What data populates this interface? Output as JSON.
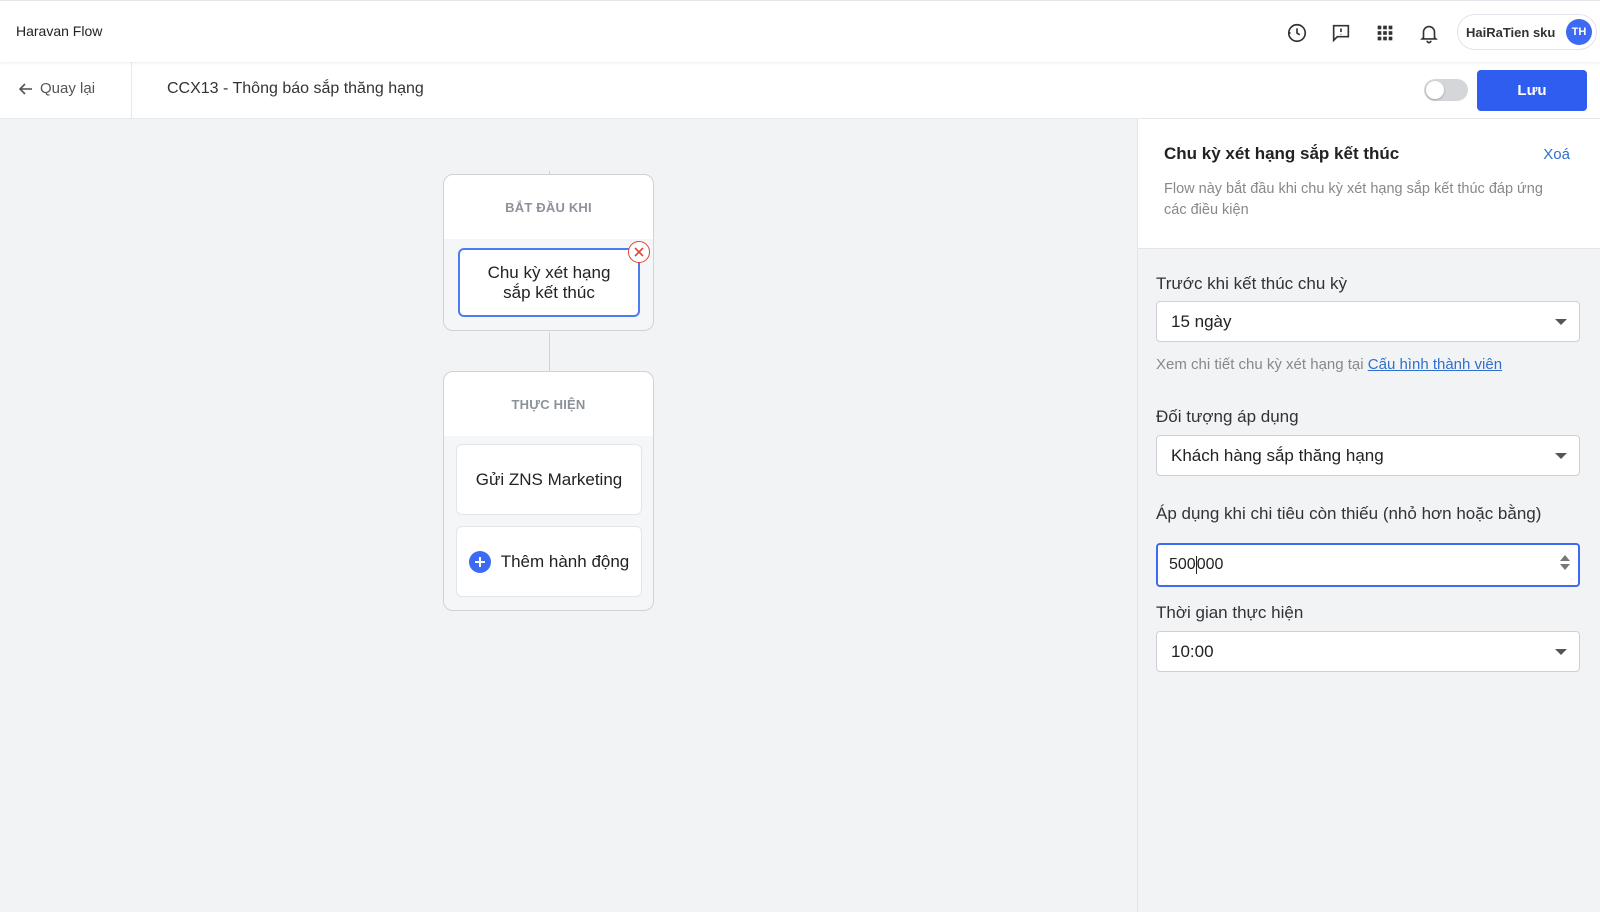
{
  "header": {
    "brand": "Haravan Flow",
    "icons": [
      "history-icon",
      "feedback-icon",
      "apps-grid-icon",
      "bell-icon"
    ],
    "user": {
      "name": "HaiRaTien sku",
      "initials": "TH"
    },
    "accent_color": "#2f5df0"
  },
  "subheader": {
    "back_label": "Quay lại",
    "flow_title": "CCX13 - Thông báo sắp thăng hạng",
    "active_toggle": false,
    "save_label": "Lưu"
  },
  "canvas": {
    "trigger_group": {
      "title": "BẮT ĐẦU KHI",
      "trigger_label": "Chu kỳ xét hạng sắp kết thúc"
    },
    "action_group": {
      "title": "THỰC HIỆN",
      "actions": [
        "Gửi ZNS Marketing"
      ],
      "add_action_label": "Thêm hành động"
    }
  },
  "panel": {
    "title": "Chu kỳ xét hạng sắp kết thúc",
    "delete_label": "Xoá",
    "description": "Flow này bắt đầu khi chu kỳ xét hạng sắp kết thúc đáp ứng các điều kiện",
    "fields": {
      "before_end": {
        "label": "Trước khi kết thúc chu kỳ",
        "value": "15 ngày"
      },
      "hint_text": "Xem chi tiết chu kỳ xét hạng tại",
      "hint_link": "Cấu hình thành viên",
      "target": {
        "label": "Đối tượng áp dụng",
        "value": "Khách hàng sắp thăng hạng"
      },
      "spend_gap": {
        "label": "Áp dụng khi chi tiêu còn thiếu (nhỏ hơn hoặc bằng)",
        "value_before_cursor": "500",
        "value_after_cursor": "000"
      },
      "run_time": {
        "label": "Thời gian thực hiện",
        "value": "10:00"
      }
    }
  }
}
